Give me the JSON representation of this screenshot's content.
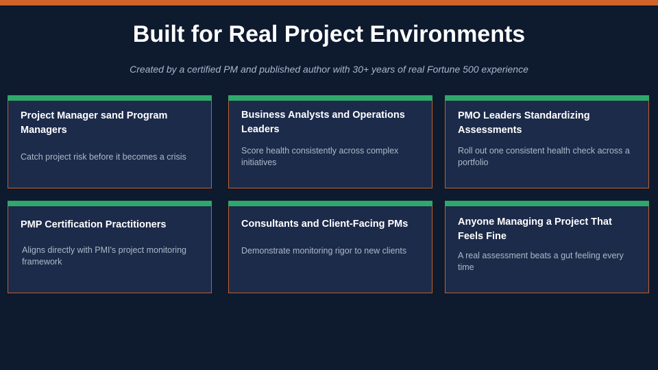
{
  "slide": {
    "title": "Built for Real Project Environments",
    "subtitle": "Created by a certified PM and published author with 30+ years of real Fortune 500 experience"
  },
  "colors": {
    "background": "#0e1a2e",
    "top_bar": "#d0632a",
    "card_background": "#1c2b4a",
    "card_border": "#c4602b",
    "card_accent": "#2fa86b"
  },
  "cards": [
    {
      "title": "Project Manager sand Program Managers",
      "description": "Catch project risk before it becomes a crisis"
    },
    {
      "title": "Business Analysts and Operations Leaders",
      "description": "Score health consistently across complex initiatives"
    },
    {
      "title": "PMO Leaders Standardizing Assessments",
      "description": "Roll out one consistent health check across a portfolio"
    },
    {
      "title": "PMP Certification Practitioners",
      "description": "Aligns directly with PMI's project monitoring framework"
    },
    {
      "title": "Consultants and Client-Facing PMs",
      "description": "Demonstrate monitoring rigor to new clients"
    },
    {
      "title": "Anyone Managing a Project That Feels Fine",
      "description": "A real assessment beats a gut feeling every time"
    }
  ]
}
